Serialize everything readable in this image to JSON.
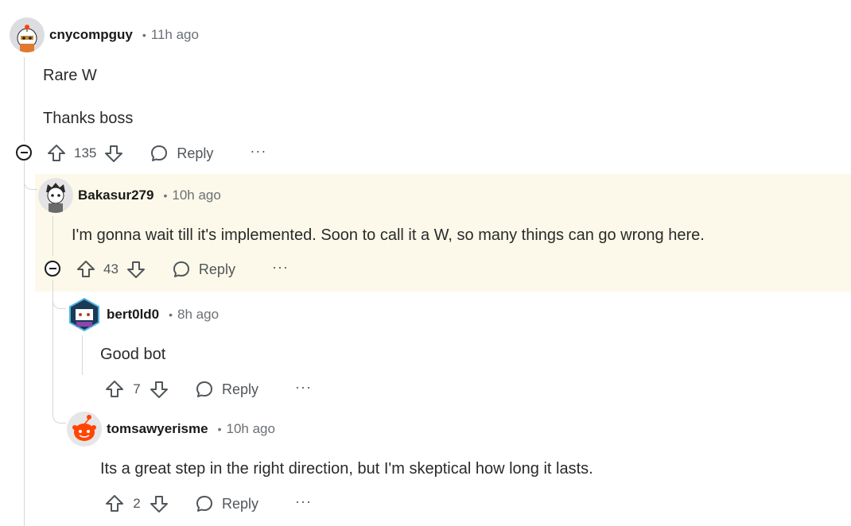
{
  "comments": [
    {
      "username": "cnycompguy",
      "separator": "•",
      "time": "11h ago",
      "body": [
        "Rare W",
        "Thanks boss"
      ],
      "score": "135",
      "reply_label": "Reply",
      "more_label": "···"
    },
    {
      "username": "Bakasur279",
      "separator": "•",
      "time": "10h ago",
      "body": [
        "I'm gonna wait till it's implemented. Soon to call it a W, so many things can go wrong here."
      ],
      "score": "43",
      "reply_label": "Reply",
      "more_label": "···"
    },
    {
      "username": "bert0ld0",
      "separator": "•",
      "time": "8h ago",
      "body": [
        "Good bot"
      ],
      "score": "7",
      "reply_label": "Reply",
      "more_label": "···"
    },
    {
      "username": "tomsawyerisme",
      "separator": "•",
      "time": "10h ago",
      "body": [
        "Its a great step in the right direction, but I'm skeptical how long it lasts."
      ],
      "score": "2",
      "reply_label": "Reply",
      "more_label": "···"
    }
  ],
  "colors": {
    "highlight": "#fcf9ea",
    "rail": "#d6d6d6",
    "meta_text": "#6b7075",
    "action_text": "#51565a",
    "snoo_orange": "#ff4500"
  },
  "icons": {
    "upvote": "arrow-up-outline-icon",
    "downvote": "arrow-down-outline-icon",
    "reply": "speech-bubble-icon",
    "collapse": "minus-circle-icon"
  }
}
